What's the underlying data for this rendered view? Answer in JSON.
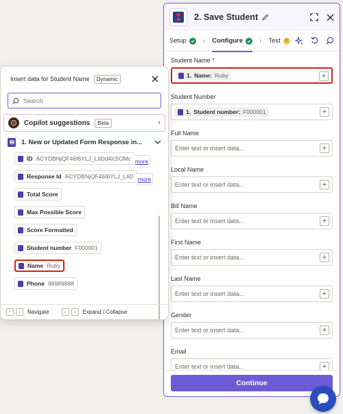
{
  "step": {
    "number": "2.",
    "title": "Save Student",
    "tabs": [
      {
        "label": "Setup",
        "status": "complete"
      },
      {
        "label": "Configure",
        "status": "complete"
      },
      {
        "label": "Test",
        "status": "warning",
        "badge": "!"
      }
    ]
  },
  "fields": [
    {
      "label": "Student Name",
      "required": true,
      "pill_number": "1.",
      "pill_name": "Name:",
      "pill_value": "Ruby"
    },
    {
      "label": "Student Number",
      "required": false,
      "pill_number": "1.",
      "pill_name": "Student number:",
      "pill_value": "F000001"
    },
    {
      "label": "Full Name",
      "placeholder": "Enter text or insert data..."
    },
    {
      "label": "Local Name",
      "placeholder": "Enter text or insert data..."
    },
    {
      "label": "Bill Name",
      "placeholder": "Enter text or insert data..."
    },
    {
      "label": "First Name",
      "placeholder": "Enter text or insert data..."
    },
    {
      "label": "Last Name",
      "placeholder": "Enter text or insert data..."
    },
    {
      "label": "Gender",
      "placeholder": "Enter text or insert data..."
    },
    {
      "label": "Email",
      "placeholder": "Enter text or insert data..."
    }
  ],
  "required_marker": "*",
  "continue_label": "Continue",
  "popup": {
    "title": "Insert data for Student Name",
    "mode_badge": "Dynamic",
    "search_placeholder": "Search",
    "copilot_label": "Copilot suggestions",
    "copilot_badge": "Beta",
    "trigger_label": "1.  New or Updated Form Response in...",
    "items": [
      {
        "name": "ID",
        "value": "ACYDBNjQF46I6YLJ_LIiDd4ic5OMc",
        "more": "more"
      },
      {
        "name": "Response Id",
        "value": "ACYDBNjQF46I6YLJ_LIiD",
        "more": "more"
      },
      {
        "name": "Total Score",
        "value": ""
      },
      {
        "name": "Max Possible Score",
        "value": ""
      },
      {
        "name": "Score Formatted",
        "value": ""
      },
      {
        "name": "Student number",
        "value": "F000001"
      },
      {
        "name": "Name",
        "value": "Ruby",
        "highlighted": true
      },
      {
        "name": "Phone",
        "value": "98989898"
      }
    ],
    "footer": {
      "up": "↑",
      "down": "↓",
      "navigate": "Navigate",
      "left": "←",
      "right": "→",
      "expand": "Expand / Collapse"
    }
  },
  "colors": {
    "accent": "#6b5bd6",
    "success": "#1e8a52",
    "warning": "#f5c542",
    "highlight": "#d72020",
    "chat": "#2a4dbb"
  }
}
